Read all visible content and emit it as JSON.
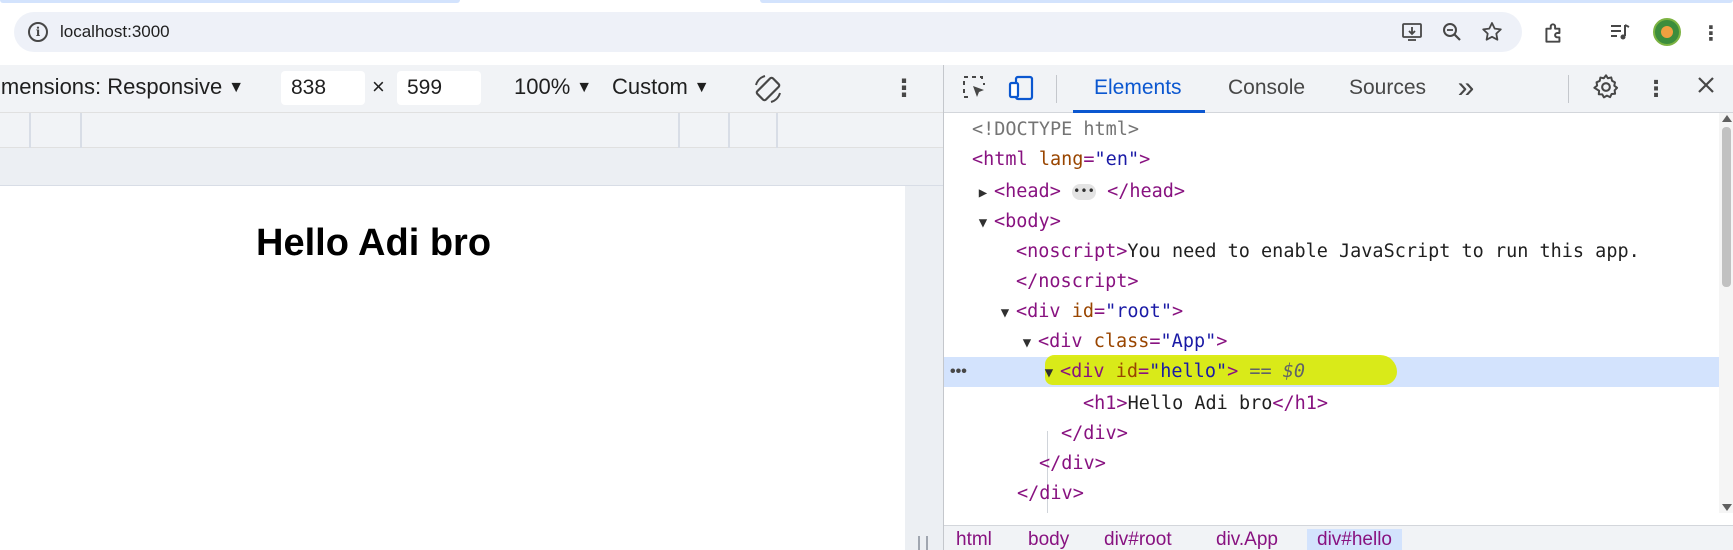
{
  "browser": {
    "url": "localhost:3000"
  },
  "device_toolbar": {
    "dimensions_label": "imensions: Responsive",
    "width": "838",
    "height": "599",
    "times": "×",
    "zoom": "100%",
    "throttle": "Custom"
  },
  "page": {
    "heading": "Hello Adi bro"
  },
  "devtools": {
    "tabs": [
      "Elements",
      "Console",
      "Sources"
    ],
    "active_tab": "Elements",
    "more_tabs": "»",
    "dom": {
      "doctype": "<!DOCTYPE html>",
      "html_open": "<html",
      "html_attr": "lang",
      "html_val": "\"en\"",
      "head_open": "<head>",
      "head_close": "</head>",
      "body_open": "<body>",
      "noscript_open": "<noscript>",
      "noscript_text": "You need to enable JavaScript to run this app.",
      "noscript_close": "</noscript>",
      "root_open": "<div",
      "root_attr": "id",
      "root_val": "\"root\"",
      "app_open": "<div",
      "app_attr": "class",
      "app_val": "\"App\"",
      "hello_open": "<div",
      "hello_attr": "id",
      "hello_val": "\"hello\"",
      "hello_marker": "== $0",
      "h1_open": "<h1>",
      "h1_text": "Hello Adi bro",
      "h1_close": "</h1>",
      "div_close": "</div>"
    },
    "breadcrumbs": [
      "html",
      "body",
      "div#root",
      "div.App",
      "div#hello"
    ],
    "highlight_color": "#d9ea00",
    "accent_color": "#0b57d0"
  }
}
